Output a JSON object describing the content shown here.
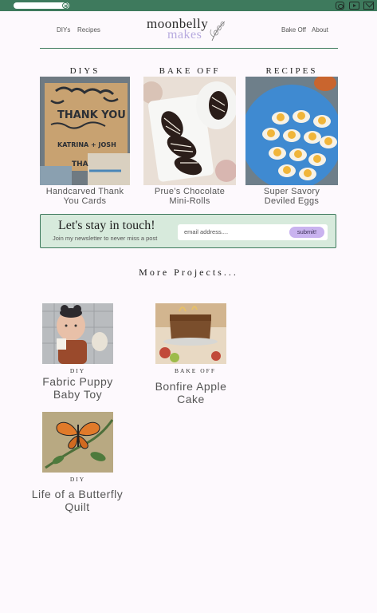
{
  "topbar": {
    "search_value": "",
    "social": [
      "instagram-icon",
      "youtube-icon",
      "mail-icon"
    ],
    "accent": "#3e7a5d"
  },
  "nav": {
    "diys": "DIYs",
    "recipes": "Recipes",
    "bake_off": "Bake Off",
    "about": "About"
  },
  "logo": {
    "line1": "moonbelly",
    "line2": "makes",
    "line2_color": "#b7aadf"
  },
  "featured": [
    {
      "heading": "DIYS",
      "caption_line1": "Handcarved Thank",
      "caption_line2": "You Cards"
    },
    {
      "heading": "BAKE OFF",
      "caption_line1": "Prue’s Chocolate",
      "caption_line2": "Mini-Rolls"
    },
    {
      "heading": "RECIPES",
      "caption_line1": "Super Savory",
      "caption_line2": "Deviled Eggs"
    }
  ],
  "newsletter": {
    "title": "Let's stay in touch!",
    "subtitle": "Join my newsletter to never miss a post",
    "placeholder": "email address....",
    "button": "submit!",
    "bg": "#d7eadc",
    "button_color": "#c9b3ef"
  },
  "more": {
    "heading": "More Projects...",
    "items": [
      {
        "category": "DIY",
        "title_line1": "Fabric Puppy",
        "title_line2": "Baby Toy"
      },
      {
        "category": "BAKE OFF",
        "title_line1": "Bonfire Apple",
        "title_line2": "Cake"
      },
      {
        "category": "DIY",
        "title_line1": "Life of a Butterfly",
        "title_line2": "Quilt"
      }
    ]
  }
}
